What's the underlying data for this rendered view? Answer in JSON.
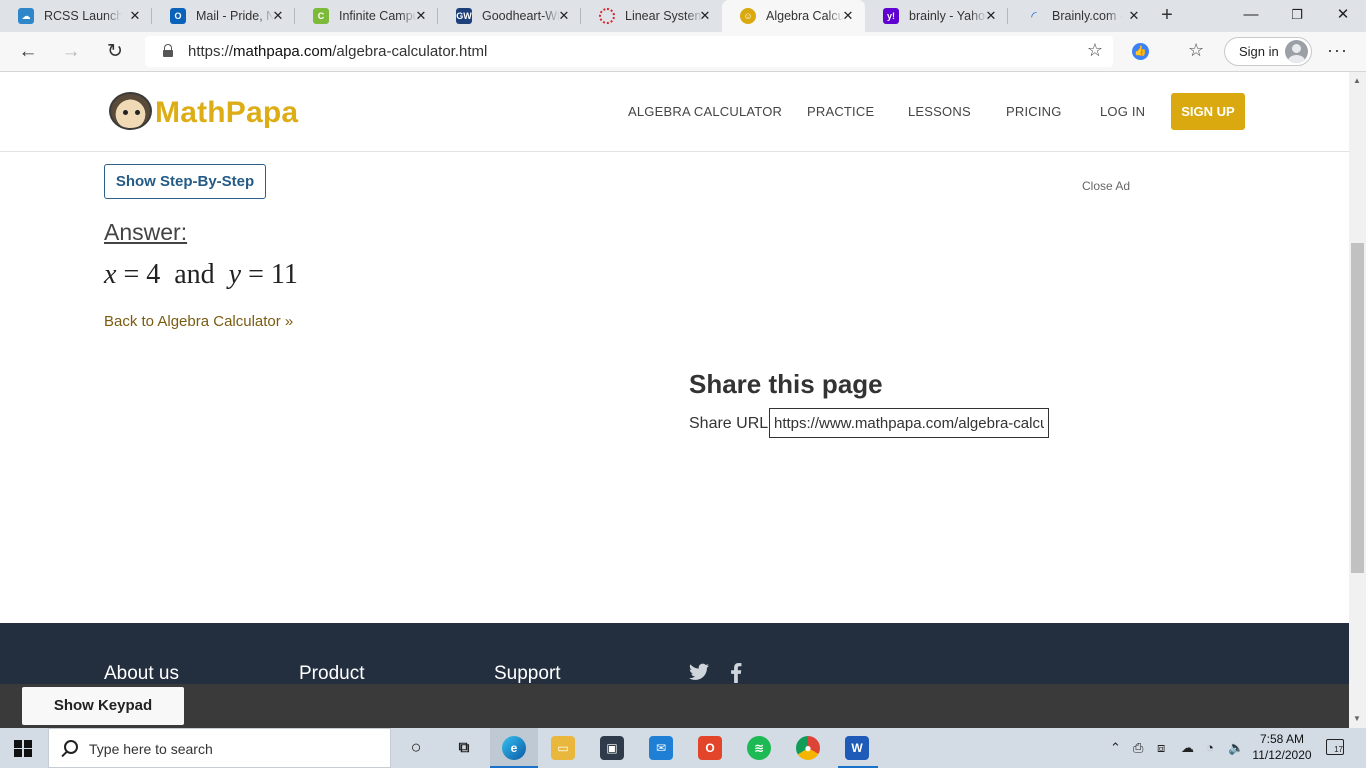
{
  "browser": {
    "tabs": [
      {
        "title": "RCSS LaunchPad",
        "favicon": "cloud-icon",
        "color": "#2f86c9",
        "active": false
      },
      {
        "title": "Mail - Pride, N",
        "favicon": "outlook-icon",
        "color": "#0a63b8",
        "active": false
      },
      {
        "title": "Infinite Campus",
        "favicon": "campus-icon",
        "color": "#7dba3a",
        "active": false
      },
      {
        "title": "Goodheart-Willcox",
        "favicon": "gw-icon",
        "color": "#1d3f7a",
        "active": false
      },
      {
        "title": "Linear Systems",
        "favicon": "ring-icon",
        "color": "#d9242a",
        "active": false
      },
      {
        "title": "Algebra Calculator",
        "favicon": "mathpapa-icon",
        "color": "#d9a90f",
        "active": true
      },
      {
        "title": "brainly - Yahoo",
        "favicon": "yahoo-icon",
        "color": "#5f01d1",
        "active": false
      },
      {
        "title": "Brainly.com - For",
        "favicon": "brainly-icon",
        "color": "#1f6fd6",
        "active": false
      }
    ],
    "url_prefix": "https://",
    "url_host": "mathpapa.com",
    "url_path": "/algebra-calculator.html",
    "signin_label": "Sign in"
  },
  "site": {
    "logo": "MathPapa",
    "nav": [
      "ALGEBRA CALCULATOR",
      "PRACTICE",
      "LESSONS",
      "PRICING",
      "LOG IN"
    ],
    "signup": "SIGN UP"
  },
  "result": {
    "step_button": "Show Step-By-Step",
    "close_ad": "Close Ad",
    "answer_heading": "Answer:",
    "answer": {
      "var1": "x",
      "val1": "4",
      "joiner": "and",
      "var2": "y",
      "val2": "11"
    },
    "back_link": "Back to Algebra Calculator »"
  },
  "share": {
    "title": "Share this page",
    "label": "Share URL:",
    "url": "https://www.mathpapa.com/algebra-calculator.html"
  },
  "footer": {
    "columns": [
      "About us",
      "Product",
      "Support"
    ],
    "social": [
      "twitter-icon",
      "facebook-icon"
    ],
    "keypad": "Show Keypad"
  },
  "taskbar": {
    "search_placeholder": "Type here to search",
    "time": "7:58 AM",
    "date": "11/12/2020",
    "notifications": "17"
  }
}
